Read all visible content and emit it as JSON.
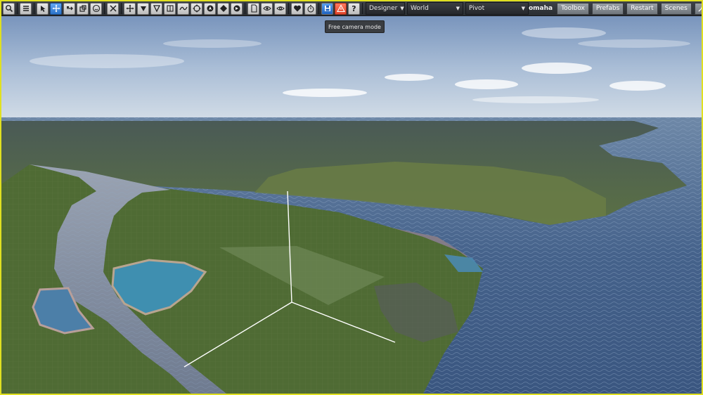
{
  "toolbar": {
    "mode_dropdown": "Designer",
    "space_dropdown": "World",
    "pivot_dropdown": "Pivot",
    "help_glyph": "?",
    "user": "omaha",
    "buttons": [
      "Toolbox",
      "Prefabs",
      "Restart",
      "Scenes"
    ]
  },
  "tooltip": "Free camera mode",
  "icons": [
    "search-icon",
    "menu-icon",
    "select-icon",
    "move-icon",
    "rotate-icon",
    "scale-icon",
    "smiley-icon",
    "cut-icon",
    "snap-icon",
    "drop-down-icon",
    "drop-icon",
    "pause-frame-icon",
    "route-icon",
    "target-icon",
    "compass-icon",
    "diamond-icon",
    "rotate-circle-icon",
    "document-icon",
    "eye-icon",
    "eye-outline-icon",
    "heart-icon",
    "stopwatch-icon",
    "save-icon",
    "warning-icon",
    "help-icon",
    "wrench-icon",
    "close-icon"
  ],
  "colors": {
    "accent": "#2a72c9",
    "warn": "#e0462c",
    "border": "#e0e020",
    "sea": "#3c5a80",
    "land": "#4e6b3a"
  }
}
